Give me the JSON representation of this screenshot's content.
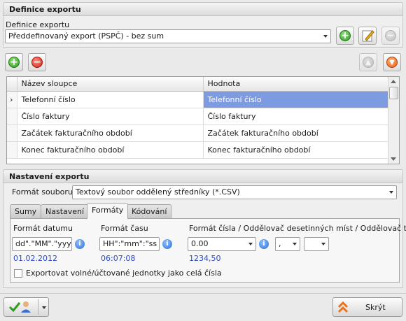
{
  "definice": {
    "section_title": "Definice exportu",
    "field_label": "Definice exportu",
    "selected": "Předdefinovaný export (PSPČ) - bez sum"
  },
  "grid": {
    "columns": [
      "Název sloupce",
      "Hodnota"
    ],
    "rows": [
      {
        "name": "Telefonní číslo",
        "value": "Telefonní číslo",
        "selected": true
      },
      {
        "name": "Číslo faktury",
        "value": "Číslo faktury",
        "selected": false
      },
      {
        "name": "Začátek fakturačního období",
        "value": "Začátek fakturačního období",
        "selected": false
      },
      {
        "name": "Konec fakturačního období",
        "value": "Konec fakturačního období",
        "selected": false
      }
    ]
  },
  "nastaveni": {
    "section_title": "Nastavení exportu",
    "format_label": "Formát souboru",
    "format_value": "Textový soubor oddělený středníky (*.CSV)"
  },
  "tabs": [
    "Sumy",
    "Nastavení",
    "Formáty",
    "Kódování"
  ],
  "active_tab": "Formáty",
  "formats": {
    "date_label": "Formát datumu",
    "date_value": "dd\".\"MM\".\"yyyy",
    "date_preview": "01.02.2012",
    "time_label": "Formát času",
    "time_value": "HH\":\"mm\":\"ss",
    "time_preview": "06:07:08",
    "number_label": "Formát čísla / Oddělovač desetinných míst / Oddělovač tisíců",
    "number_value": "0.00",
    "decimal_sep": ",",
    "thousand_sep": "",
    "number_preview": "1234,50",
    "checkbox_label": "Exportovat volné/účtované jednotky jako celá čísla",
    "checkbox_checked": false
  },
  "footer": {
    "hide_label": "Skrýt"
  },
  "icons": {
    "add": "plus-circle-icon",
    "remove": "minus-circle-icon",
    "edit": "edit-pencil-icon",
    "up": "arrow-up-icon",
    "down": "arrow-down-icon",
    "info": "info-icon",
    "confirm": "check-user-icon",
    "hide": "double-chevron-up-icon"
  },
  "colors": {
    "selection": "#7d9be0",
    "preview_text": "#2c49c8"
  }
}
